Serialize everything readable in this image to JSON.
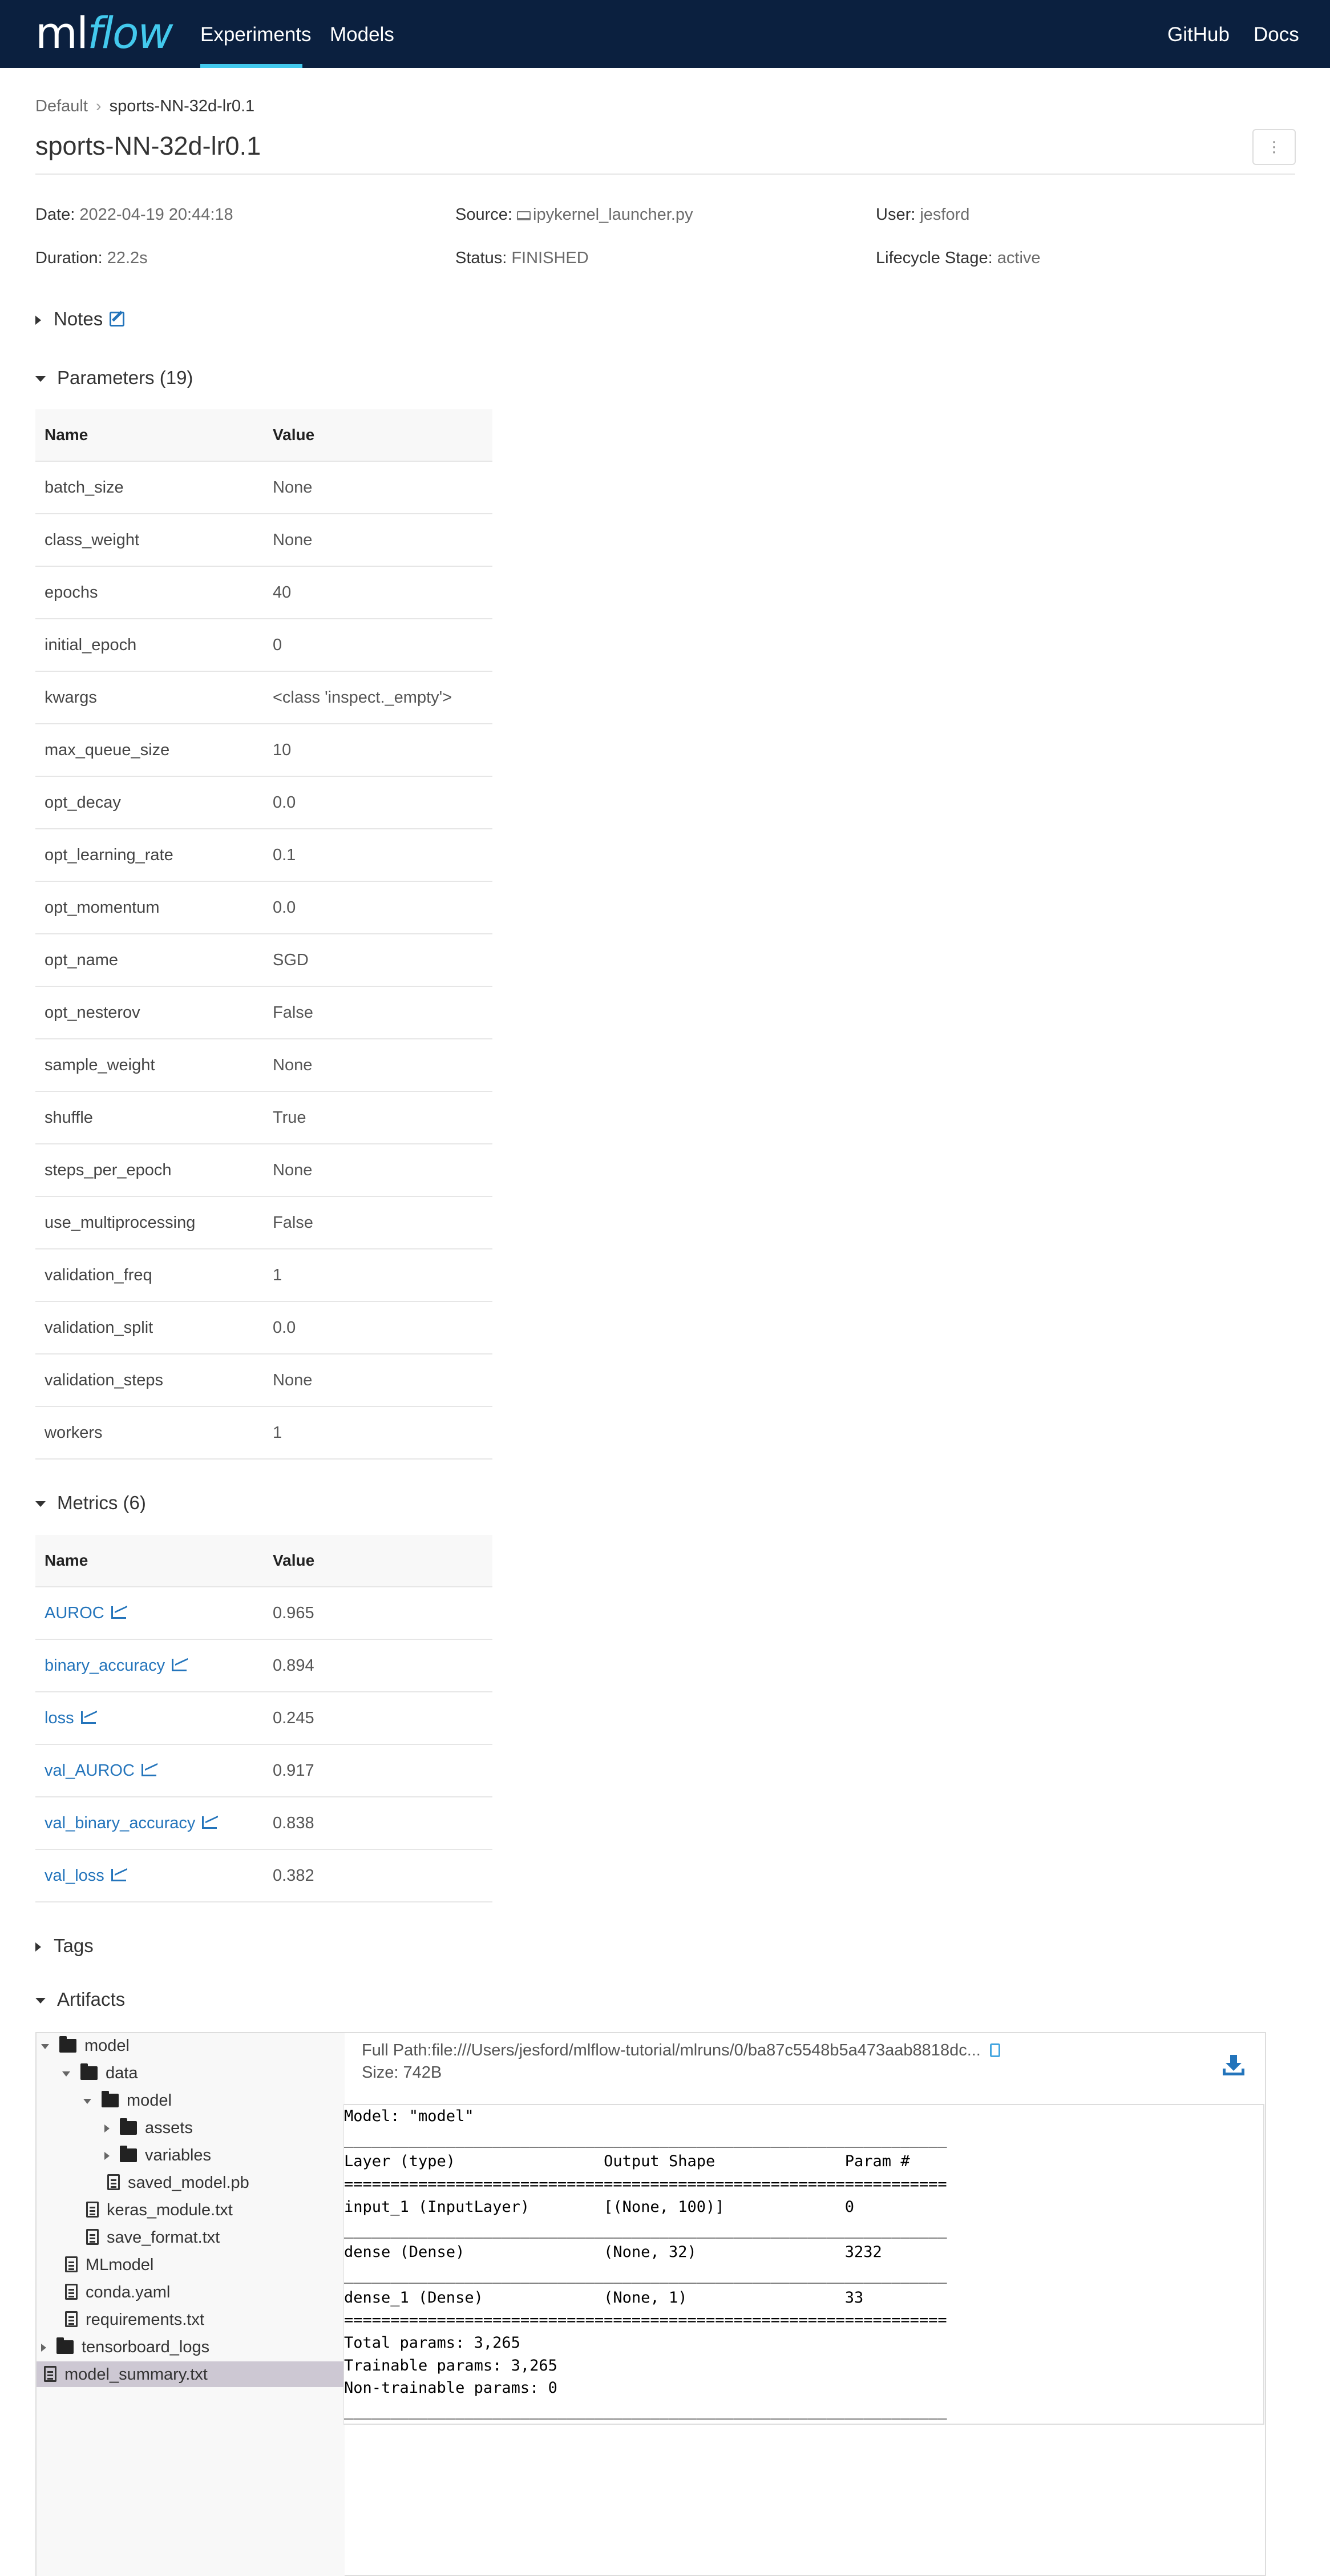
{
  "header": {
    "logo_ml": "ml",
    "logo_flow": "flow",
    "nav": {
      "experiments": "Experiments",
      "models": "Models"
    },
    "right": {
      "github": "GitHub",
      "docs": "Docs"
    }
  },
  "breadcrumb": {
    "parent": "Default",
    "current": "sports-NN-32d-lr0.1"
  },
  "page_title": "sports-NN-32d-lr0.1",
  "menu_button": "⋮",
  "metadata": {
    "date_label": "Date:",
    "date": "2022-04-19 20:44:18",
    "source_label": "Source:",
    "source": "ipykernel_launcher.py",
    "user_label": "User:",
    "user": "jesford",
    "duration_label": "Duration:",
    "duration": "22.2s",
    "status_label": "Status:",
    "status": "FINISHED",
    "lifecycle_label": "Lifecycle Stage:",
    "lifecycle": "active"
  },
  "sections": {
    "notes": "Notes",
    "parameters": "Parameters (19)",
    "metrics": "Metrics (6)",
    "tags": "Tags",
    "artifacts": "Artifacts"
  },
  "table_headers": {
    "name": "Name",
    "value": "Value"
  },
  "parameters": [
    {
      "name": "batch_size",
      "value": "None"
    },
    {
      "name": "class_weight",
      "value": "None"
    },
    {
      "name": "epochs",
      "value": "40"
    },
    {
      "name": "initial_epoch",
      "value": "0"
    },
    {
      "name": "kwargs",
      "value": "<class 'inspect._empty'>"
    },
    {
      "name": "max_queue_size",
      "value": "10"
    },
    {
      "name": "opt_decay",
      "value": "0.0"
    },
    {
      "name": "opt_learning_rate",
      "value": "0.1"
    },
    {
      "name": "opt_momentum",
      "value": "0.0"
    },
    {
      "name": "opt_name",
      "value": "SGD"
    },
    {
      "name": "opt_nesterov",
      "value": "False"
    },
    {
      "name": "sample_weight",
      "value": "None"
    },
    {
      "name": "shuffle",
      "value": "True"
    },
    {
      "name": "steps_per_epoch",
      "value": "None"
    },
    {
      "name": "use_multiprocessing",
      "value": "False"
    },
    {
      "name": "validation_freq",
      "value": "1"
    },
    {
      "name": "validation_split",
      "value": "0.0"
    },
    {
      "name": "validation_steps",
      "value": "None"
    },
    {
      "name": "workers",
      "value": "1"
    }
  ],
  "metrics": [
    {
      "name": "AUROC",
      "value": "0.965"
    },
    {
      "name": "binary_accuracy",
      "value": "0.894"
    },
    {
      "name": "loss",
      "value": "0.245"
    },
    {
      "name": "val_AUROC",
      "value": "0.917"
    },
    {
      "name": "val_binary_accuracy",
      "value": "0.838"
    },
    {
      "name": "val_loss",
      "value": "0.382"
    }
  ],
  "artifacts": {
    "tree": [
      {
        "label": "model",
        "type": "folder",
        "expanded": true,
        "depth": 0
      },
      {
        "label": "data",
        "type": "folder",
        "expanded": true,
        "depth": 1
      },
      {
        "label": "model",
        "type": "folder",
        "expanded": true,
        "depth": 2
      },
      {
        "label": "assets",
        "type": "folder",
        "expanded": false,
        "depth": 3
      },
      {
        "label": "variables",
        "type": "folder",
        "expanded": false,
        "depth": 3
      },
      {
        "label": "saved_model.pb",
        "type": "file",
        "depth": 3
      },
      {
        "label": "keras_module.txt",
        "type": "file",
        "depth": 2
      },
      {
        "label": "save_format.txt",
        "type": "file",
        "depth": 2
      },
      {
        "label": "MLmodel",
        "type": "file",
        "depth": 1
      },
      {
        "label": "conda.yaml",
        "type": "file",
        "depth": 1
      },
      {
        "label": "requirements.txt",
        "type": "file",
        "depth": 1
      },
      {
        "label": "tensorboard_logs",
        "type": "folder",
        "expanded": false,
        "depth": 0
      },
      {
        "label": "model_summary.txt",
        "type": "file",
        "depth": 0,
        "selected": true
      }
    ],
    "full_path_label": "Full Path:",
    "full_path": "file:///Users/jesford/mlflow-tutorial/mlruns/0/ba87c5548b5a473aab8818dc...",
    "size_label": "Size:",
    "size": "742B",
    "preview_text": "Model: \"model\"\n_________________________________________________________________\nLayer (type)                Output Shape              Param #   \n=================================================================\ninput_1 (InputLayer)        [(None, 100)]             0         \n_________________________________________________________________\ndense (Dense)               (None, 32)                3232      \n_________________________________________________________________\ndense_1 (Dense)             (None, 1)                 33        \n=================================================================\nTotal params: 3,265\nTrainable params: 3,265\nNon-trainable params: 0\n_________________________________________________________________"
  }
}
